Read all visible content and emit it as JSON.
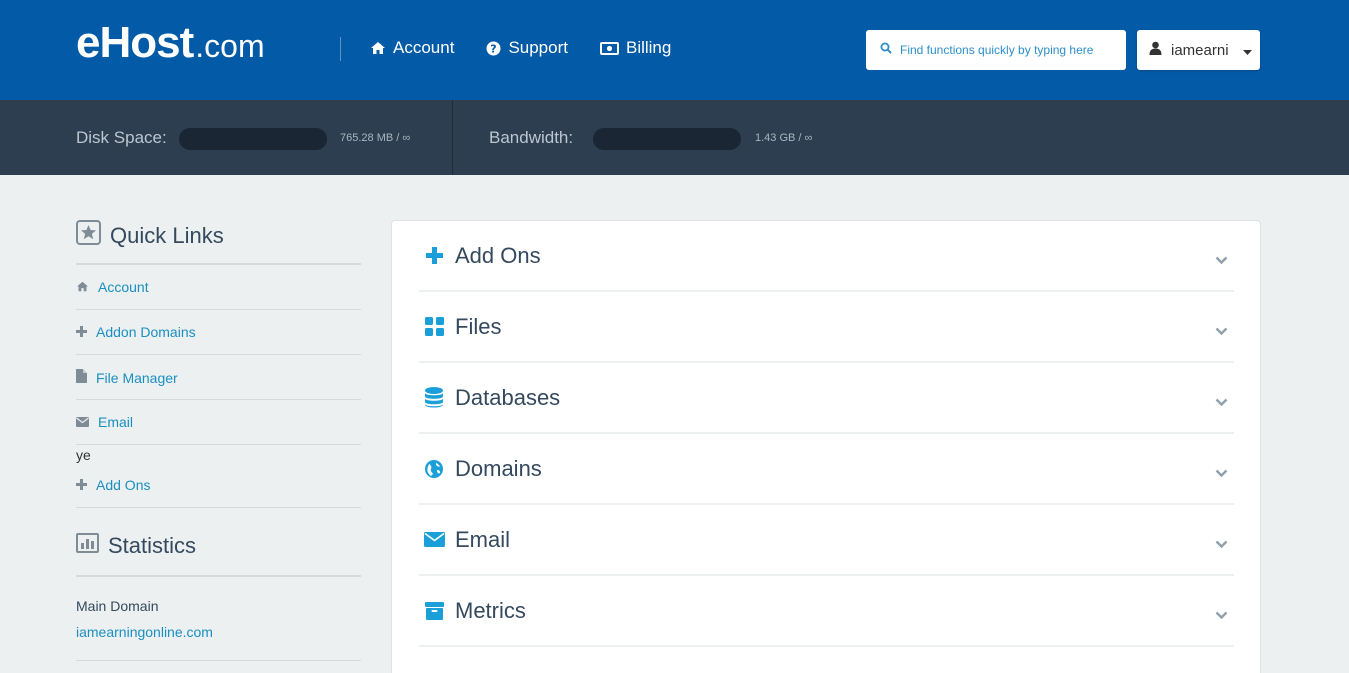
{
  "header": {
    "logo_main": "eHost",
    "logo_suffix": ".com",
    "nav": [
      {
        "label": "Account",
        "icon": "home-icon"
      },
      {
        "label": "Support",
        "icon": "help-icon"
      },
      {
        "label": "Billing",
        "icon": "money-icon"
      }
    ],
    "search_placeholder": "Find functions quickly by typing here",
    "username": "iamearni"
  },
  "usage": {
    "disk_label": "Disk Space:",
    "disk_value": "765.28 MB / ∞",
    "bandwidth_label": "Bandwidth:",
    "bandwidth_value": "1.43 GB / ∞"
  },
  "sidebar": {
    "quick_links_title": "Quick Links",
    "links": [
      {
        "label": "Account",
        "icon": "home-icon"
      },
      {
        "label": "Addon Domains",
        "icon": "plus-icon"
      },
      {
        "label": "File Manager",
        "icon": "file-icon"
      },
      {
        "label": "Email",
        "icon": "envelope-icon"
      }
    ],
    "stray_text": "ye",
    "extra_link": {
      "label": "Add Ons",
      "icon": "plus-icon"
    },
    "statistics_title": "Statistics",
    "main_domain_label": "Main Domain",
    "main_domain_value": "iamearningonline.com"
  },
  "sections": [
    {
      "label": "Add Ons",
      "icon": "plus-icon"
    },
    {
      "label": "Files",
      "icon": "grid-icon"
    },
    {
      "label": "Databases",
      "icon": "database-icon"
    },
    {
      "label": "Domains",
      "icon": "globe-icon"
    },
    {
      "label": "Email",
      "icon": "envelope-icon"
    },
    {
      "label": "Metrics",
      "icon": "archive-icon"
    }
  ],
  "colors": {
    "header_bg": "#035aa6",
    "usage_bg": "#2c3e50",
    "accent": "#1a8fc0",
    "section_icon": "#1a9fd8"
  }
}
